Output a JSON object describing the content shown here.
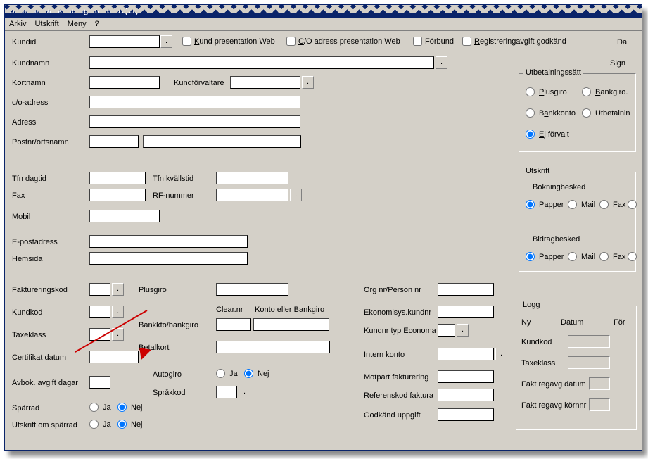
{
  "title": "Underhåll av kundregister  bild1(11)",
  "menu": {
    "arkiv": "Arkiv",
    "utskrift": "Utskrift",
    "meny": "Meny",
    "help": "?"
  },
  "labels": {
    "kundid": "Kundid",
    "kundpresweb": "Kund presentation Web",
    "copresweb": "C/O adress presentation Web",
    "forbund": "Förbund",
    "regavg": "Registreringavgift godkänd",
    "da": "Da",
    "kundnamn": "Kundnamn",
    "sign": "Sign",
    "kortnamn": "Kortnamn",
    "kundforv": "Kundförvaltare",
    "coadress": "c/o-adress",
    "adress": "Adress",
    "postnr": "Postnr/ortsnamn",
    "tfndag": "Tfn dagtid",
    "tfnkvall": "Tfn kvällstid",
    "fax": "Fax",
    "rfnummer": "RF-nummer",
    "mobil": "Mobil",
    "epost": "E-postadress",
    "hemsida": "Hemsida",
    "faktkod": "Faktureringskod",
    "plusgiro": "Plusgiro",
    "kundkod": "Kundkod",
    "clearnr": "Clear.nr",
    "kontobg": "Konto eller Bankgiro",
    "taxeklass": "Taxeklass",
    "bankkto": "Bankkto/bankgiro",
    "certdatum": "Certifikat datum",
    "betalkort": "Betalkort",
    "avbok": "Avbok. avgift dagar",
    "autogiro": "Autogiro",
    "sprakkod": "Språkkod",
    "ja": "Ja",
    "nej": "Nej",
    "sparrad": "Spärrad",
    "utskriftsparrad": "Utskrift om spärrad",
    "orgnr": "Org nr/Person nr",
    "ekokund": "Ekonomisys.kundnr",
    "kundnreco": "Kundnr typ Economa",
    "internkonto": "Intern konto",
    "motpart": "Motpart fakturering",
    "refkod": "Referenskod faktura",
    "godkand": "Godkänd uppgift"
  },
  "dotbtn": ".",
  "group_utbet": {
    "title": "Utbetalningssätt",
    "plusgiro": "Plusgiro",
    "bankgiro": "Bankgiro.",
    "bankkonto": "Bankkonto",
    "utbet": "Utbetalnin",
    "ejforvalt": "Ej förvalt"
  },
  "group_utskrift": {
    "title": "Utskrift",
    "bokning": "Bokningbesked",
    "bidrag": "Bidragbesked",
    "papper": "Papper",
    "mail": "Mail",
    "fax": "Fax"
  },
  "group_logg": {
    "title": "Logg",
    "ny": "Ny",
    "datum": "Datum",
    "for": "För",
    "kundkod": "Kundkod",
    "taxeklass": "Taxeklass",
    "faktdat": "Fakt regavg datum",
    "faktkorn": "Fakt regavg körnnr"
  }
}
